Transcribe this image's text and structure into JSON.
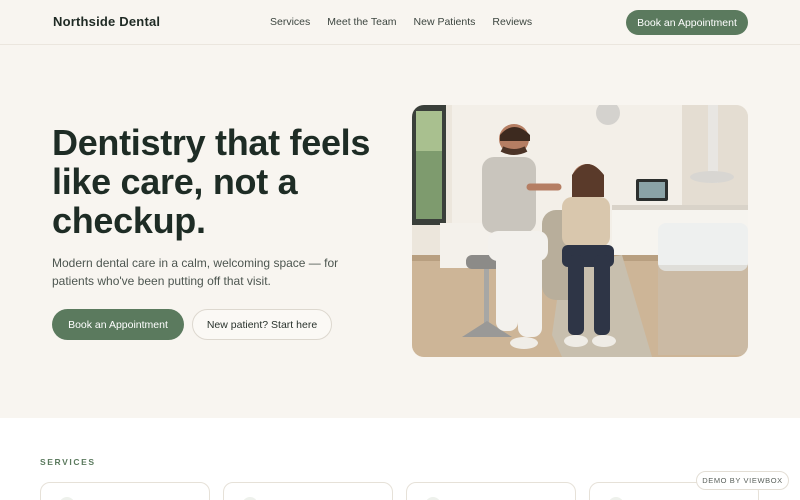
{
  "brand": {
    "name": "Northside Dental",
    "accent": "#5b7a5e"
  },
  "nav": {
    "links": [
      "Services",
      "Meet the Team",
      "New Patients",
      "Reviews"
    ],
    "cta_label": "Book an Appointment"
  },
  "hero": {
    "title": "Dentistry that feels like care, not a checkup.",
    "subtitle": "Modern dental care in a calm, welcoming space — for patients who've been putting off that visit.",
    "primary_cta": "Book an Appointment",
    "secondary_cta": "New patient? Start here",
    "image_description": "dentist-with-patient-photo"
  },
  "services": {
    "section_label": "SERVICES"
  },
  "badge": {
    "label": "DEMO BY VIEWBOX"
  }
}
